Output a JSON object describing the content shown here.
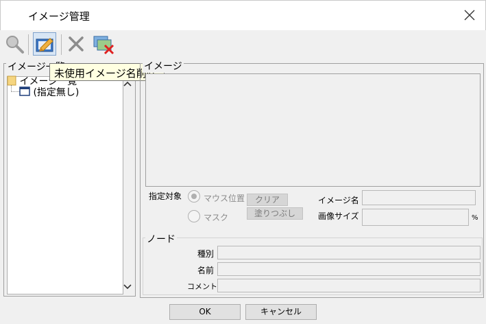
{
  "window": {
    "title": "イメージ管理"
  },
  "tooltip": {
    "text": "未使用イメージ名削除"
  },
  "left_panel": {
    "caption": "イメージ一覧",
    "tree": [
      {
        "label": "イメージ一覧"
      },
      {
        "label": "(指定無し)"
      }
    ]
  },
  "image_group": {
    "caption": "イメージ",
    "target_label": "指定対象",
    "radio_mouse": "マウス位置",
    "radio_mask": "マスク",
    "clear_button": "クリア",
    "fill_button": "塗りつぶし",
    "image_name_label": "イメージ名",
    "image_size_label": "画像サイズ",
    "percent_unit": "%"
  },
  "node_group": {
    "caption": "ノード",
    "kind_label": "種別",
    "name_label": "名前",
    "comment_label": "コメント"
  },
  "footer": {
    "ok": "OK",
    "cancel": "キャンセル"
  },
  "colors": {
    "active_border": "#7fa2cc",
    "tooltip_bg": "#ffffe1"
  }
}
